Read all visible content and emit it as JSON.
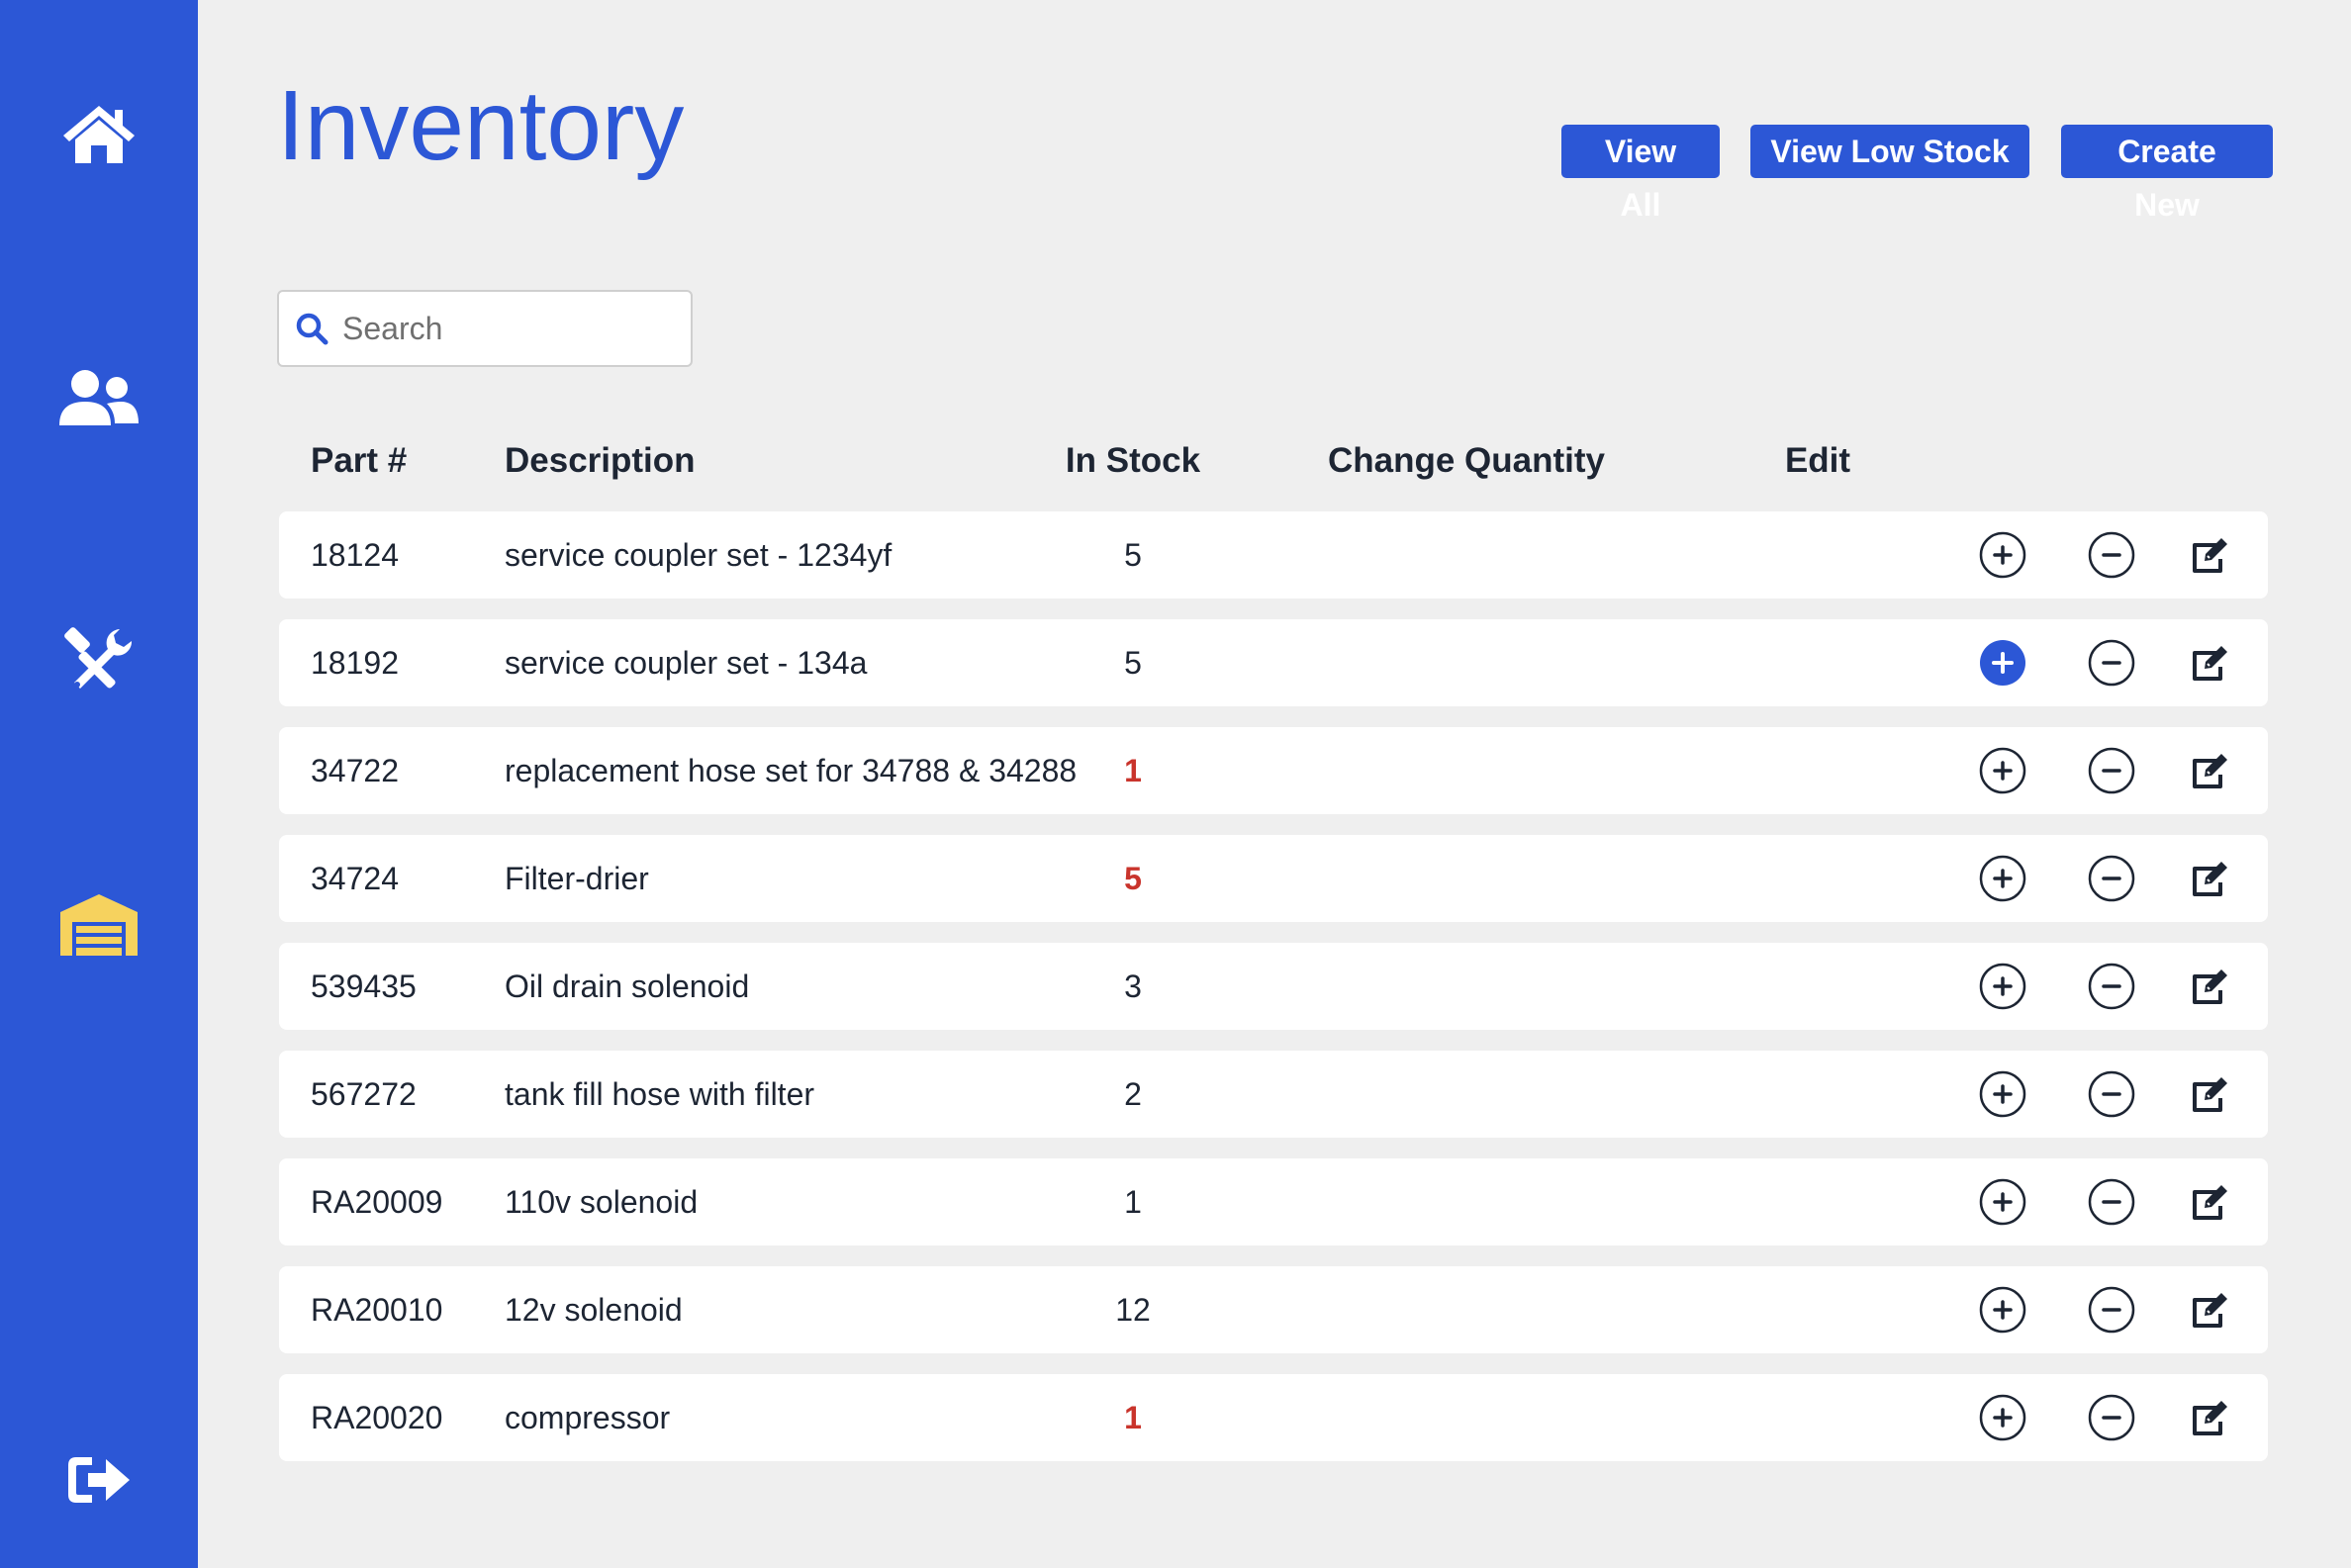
{
  "sidebar": {
    "items": [
      {
        "icon": "home-icon",
        "name": "home"
      },
      {
        "icon": "users-icon",
        "name": "customers"
      },
      {
        "icon": "tools-icon",
        "name": "services"
      },
      {
        "icon": "warehouse-icon",
        "name": "inventory",
        "active": true
      },
      {
        "icon": "sign-out-icon",
        "name": "logout"
      }
    ],
    "background": "#2c57d6",
    "active_color": "#f6d25e"
  },
  "header": {
    "title": "Inventory",
    "buttons": {
      "view_all": "View All",
      "view_low_stock": "View Low Stock",
      "create_new": "Create New"
    }
  },
  "search": {
    "placeholder": "Search",
    "value": ""
  },
  "table": {
    "columns": [
      "Part #",
      "Description",
      "In Stock",
      "Change Quantity",
      "Edit"
    ],
    "rows": [
      {
        "part": "18124",
        "description": "service coupler set - 1234yf",
        "stock": "5",
        "low": false
      },
      {
        "part": "18192",
        "description": "service coupler set - 134a",
        "stock": "5",
        "low": false,
        "plus_active": true
      },
      {
        "part": "34722",
        "description": "replacement hose set for 34788 & 34288",
        "stock": "1",
        "low": true
      },
      {
        "part": "34724",
        "description": "Filter-drier",
        "stock": "5",
        "low": true
      },
      {
        "part": "539435",
        "description": "Oil drain solenoid",
        "stock": "3",
        "low": false
      },
      {
        "part": "567272",
        "description": "tank fill hose with filter",
        "stock": "2",
        "low": false
      },
      {
        "part": "RA20009",
        "description": "110v solenoid",
        "stock": "1",
        "low": false
      },
      {
        "part": "RA20010",
        "description": "12v solenoid",
        "stock": "12",
        "low": false
      },
      {
        "part": "RA20020",
        "description": "compressor",
        "stock": "1",
        "low": true
      }
    ]
  },
  "colors": {
    "accent": "#2c57d6",
    "low_stock": "#c9342c",
    "background": "#efefef"
  }
}
